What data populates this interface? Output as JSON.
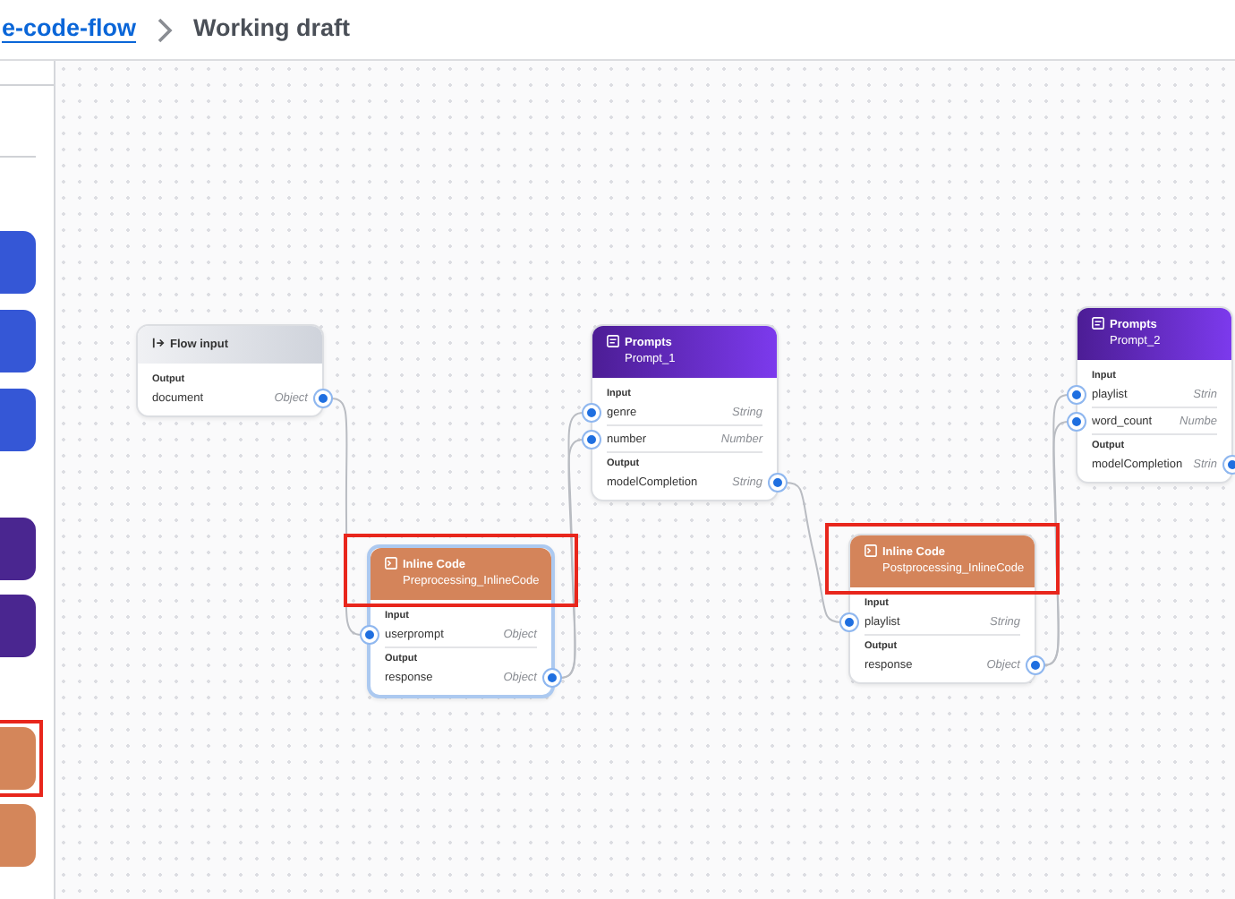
{
  "breadcrumb": {
    "link": "e-code-flow",
    "current": "Working draft"
  },
  "palette": [
    {
      "color": "#3557d6",
      "highlighted": false
    },
    {
      "color": "#3557d6",
      "highlighted": false
    },
    {
      "color": "#3557d6",
      "highlighted": false
    },
    {
      "color": "#4a2690",
      "highlighted": false
    },
    {
      "color": "#4a2690",
      "highlighted": false
    },
    {
      "color": "#d4865a",
      "highlighted": true
    },
    {
      "color": "#d4865a",
      "highlighted": false
    }
  ],
  "nodes": [
    {
      "kind": "input",
      "title": "Flow input",
      "selected": false,
      "highlighted": false,
      "output_label": "Output",
      "outputs": [
        {
          "name": "document",
          "type": "Object"
        }
      ]
    },
    {
      "kind": "code",
      "title": "Inline Code",
      "subtitle": "Preprocessing_InlineCode",
      "selected": true,
      "highlighted": true,
      "input_label": "Input",
      "inputs": [
        {
          "name": "userprompt",
          "type": "Object"
        }
      ],
      "output_label": "Output",
      "outputs": [
        {
          "name": "response",
          "type": "Object"
        }
      ]
    },
    {
      "kind": "prompt",
      "title": "Prompts",
      "subtitle": "Prompt_1",
      "selected": false,
      "highlighted": false,
      "input_label": "Input",
      "inputs": [
        {
          "name": "genre",
          "type": "String"
        },
        {
          "name": "number",
          "type": "Number"
        }
      ],
      "output_label": "Output",
      "outputs": [
        {
          "name": "modelCompletion",
          "type": "String"
        }
      ]
    },
    {
      "kind": "code",
      "title": "Inline Code",
      "subtitle": "Postprocessing_InlineCode",
      "selected": false,
      "highlighted": true,
      "input_label": "Input",
      "inputs": [
        {
          "name": "playlist",
          "type": "String"
        }
      ],
      "output_label": "Output",
      "outputs": [
        {
          "name": "response",
          "type": "Object"
        }
      ]
    },
    {
      "kind": "prompt",
      "title": "Prompts",
      "subtitle": "Prompt_2",
      "selected": false,
      "highlighted": false,
      "input_label": "Input",
      "inputs": [
        {
          "name": "playlist",
          "type": "Strin"
        },
        {
          "name": "word_count",
          "type": "Numbe"
        }
      ],
      "output_label": "Output",
      "outputs": [
        {
          "name": "modelCompletion",
          "type": "Strin"
        }
      ]
    }
  ]
}
